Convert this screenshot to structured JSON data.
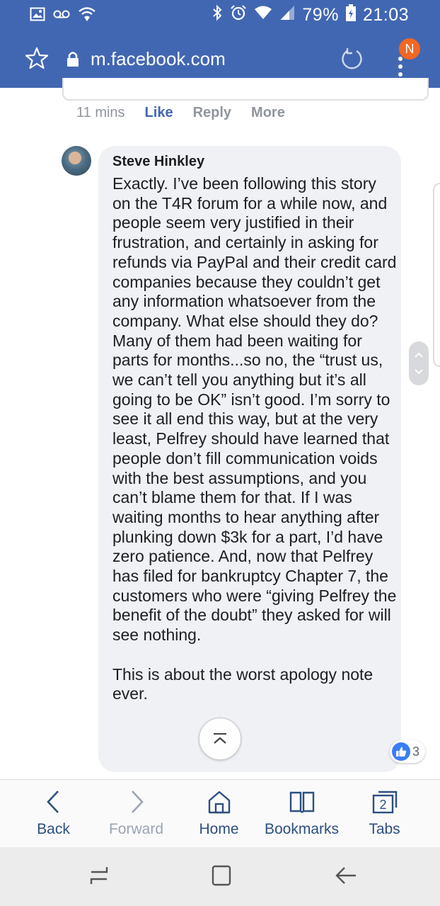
{
  "status_bar": {
    "battery": "79%",
    "time": "21:03",
    "left_icons": [
      "image-icon",
      "voicemail-icon",
      "wifi-icon"
    ],
    "right_icons": [
      "bluetooth-icon",
      "alarm-icon",
      "wifi-icon",
      "signal-icon",
      "battery-icon"
    ]
  },
  "browser": {
    "url": "m.facebook.com",
    "notification_badge": "N"
  },
  "comment_meta": {
    "time": "11 mins",
    "like": "Like",
    "reply": "Reply",
    "more": "More"
  },
  "comment": {
    "author": "Steve Hinkley",
    "paragraphs": [
      "Exactly. I’ve been following this story on the T4R forum for a while now, and people seem very justified in their frustration, and certainly in asking for refunds via PayPal and their credit card companies because they couldn’t get any information whatsoever from the company. What else should they do? Many of them had been waiting for parts for months...so no, the “trust us, we can’t tell you anything but it’s all going to be OK” isn’t good. I’m sorry to see it all end this way, but at the very least, Pelfrey should have learned that people don’t fill communication voids with the best assumptions, and you can’t blame them for that. If I was waiting months to hear anything after plunking down $3k for a part, I’d have zero patience. And, now that Pelfrey has filed for bankruptcy Chapter 7, the customers who were “giving Pelfrey the benefit of the doubt” they asked for will see nothing.",
      "This is about the worst apology note ever."
    ],
    "reaction_count": "3"
  },
  "browser_nav": {
    "back": "Back",
    "forward": "Forward",
    "home": "Home",
    "bookmarks": "Bookmarks",
    "tabs": "Tabs",
    "tab_count": "2"
  },
  "colors": {
    "facebook_blue": "#4267b2",
    "badge_orange": "#f26722",
    "bubble_bg": "#f0f1f4",
    "like_blue": "#3b7df5"
  }
}
